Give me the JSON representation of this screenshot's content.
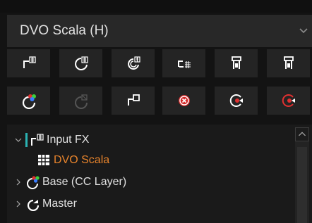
{
  "selector": {
    "value": "DVO Scala (H)",
    "arrow_icon": "chevron-down-icon"
  },
  "toolbar": {
    "row1": [
      {
        "name": "insert-node-button",
        "icon": "node-insert-icon"
      },
      {
        "name": "add-corrector-button",
        "icon": "corrector-icon"
      },
      {
        "name": "parallel-node-button",
        "icon": "parallel-icon"
      },
      {
        "name": "layer-mixer-button",
        "icon": "layer-mixer-icon"
      },
      {
        "name": "splitter-button",
        "icon": "splitter-icon"
      },
      {
        "name": "combiner-button",
        "icon": "combiner-icon"
      }
    ],
    "row2": [
      {
        "name": "color-layer-button",
        "icon": "color-layer-icon"
      },
      {
        "name": "disabled-layer-button",
        "icon": "disabled-layer-icon"
      },
      {
        "name": "compound-node-button",
        "icon": "compound-node-icon"
      },
      {
        "name": "delete-node-button",
        "icon": "delete-x-icon"
      },
      {
        "name": "reset-grade-button",
        "icon": "reset-icon"
      },
      {
        "name": "reset-all-button",
        "icon": "reset-all-icon"
      }
    ]
  },
  "tree": {
    "items": [
      {
        "label": "Input FX",
        "expanded": true,
        "icon": "input-fx-icon"
      },
      {
        "label": "DVO Scala",
        "active": true,
        "accent": "#e8842c",
        "icon": "grid-icon"
      },
      {
        "label": "Base (CC Layer)",
        "expanded": false,
        "icon": "color-layer-icon"
      },
      {
        "label": "Master",
        "expanded": false,
        "icon": "master-icon"
      }
    ]
  }
}
